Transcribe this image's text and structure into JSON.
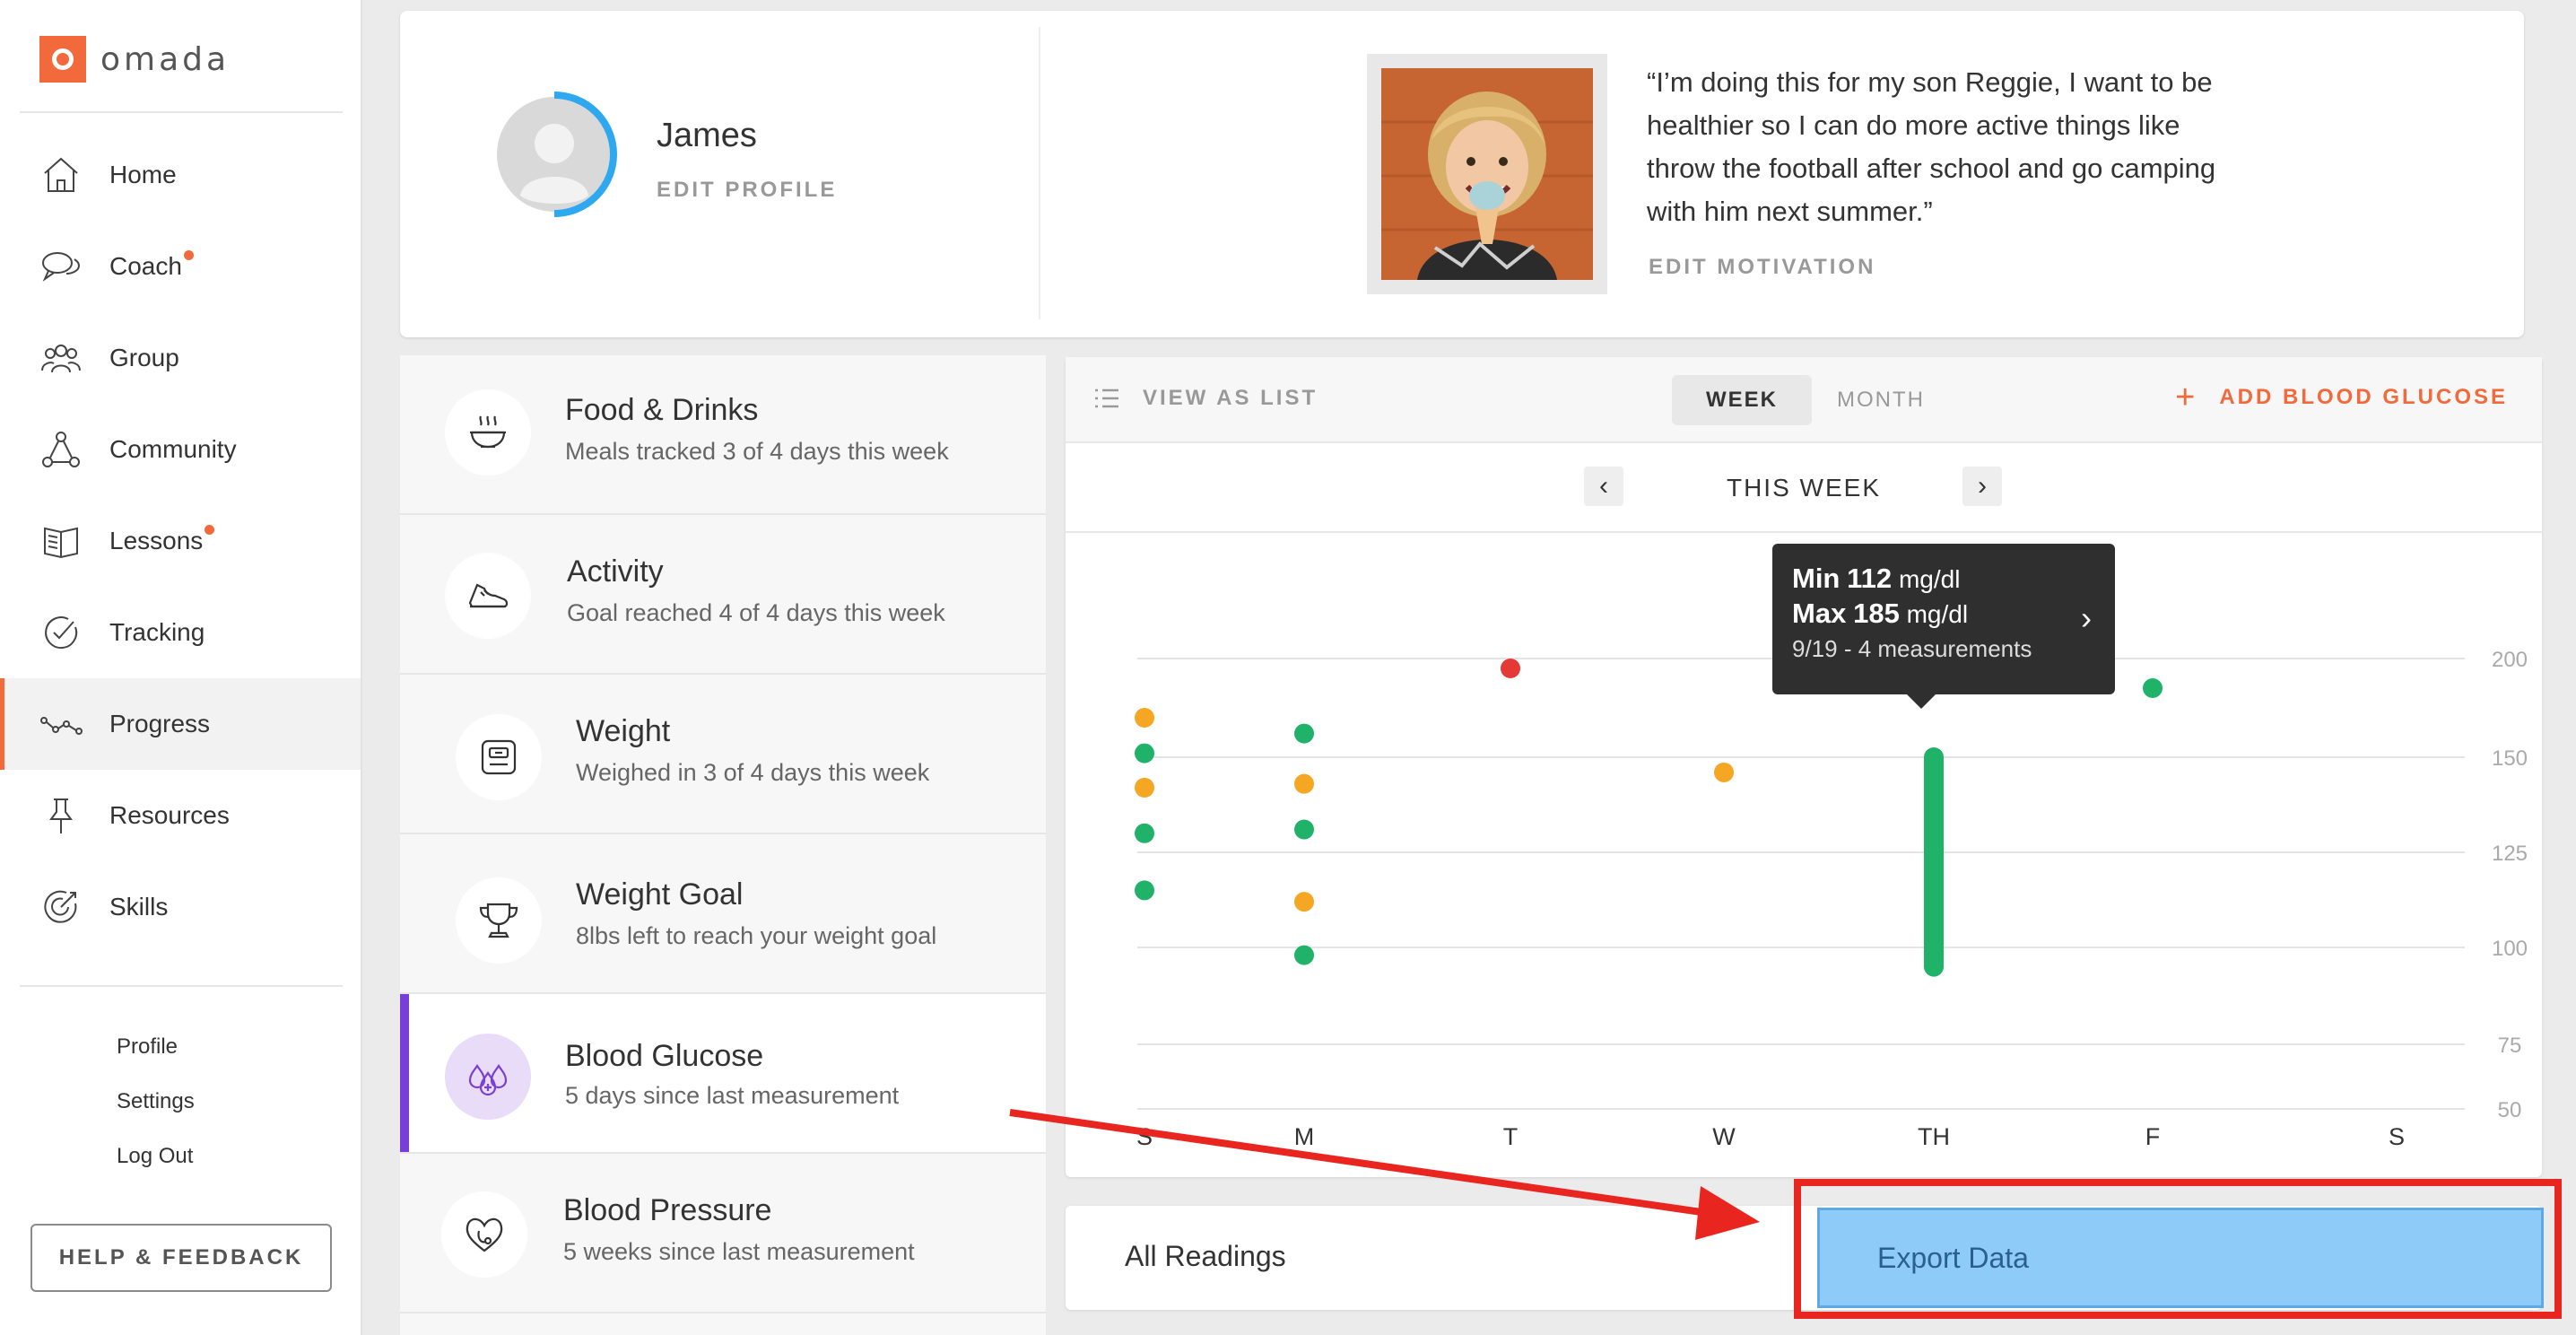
{
  "brand": {
    "name": "omada",
    "accent": "#f26a3b"
  },
  "nav": {
    "items": [
      {
        "label": "Home",
        "icon": "home-icon",
        "badge": false
      },
      {
        "label": "Coach",
        "icon": "chat-bubbles-icon",
        "badge": true
      },
      {
        "label": "Group",
        "icon": "group-icon",
        "badge": false
      },
      {
        "label": "Community",
        "icon": "community-icon",
        "badge": false
      },
      {
        "label": "Lessons",
        "icon": "book-icon",
        "badge": true
      },
      {
        "label": "Tracking",
        "icon": "checkmark-circle-icon",
        "badge": false
      },
      {
        "label": "Progress",
        "icon": "progress-line-icon",
        "badge": false,
        "active": true
      },
      {
        "label": "Resources",
        "icon": "pushpin-icon",
        "badge": false
      },
      {
        "label": "Skills",
        "icon": "target-icon",
        "badge": false
      }
    ],
    "secondary": [
      "Profile",
      "Settings",
      "Log Out"
    ],
    "help_label": "HELP & FEEDBACK"
  },
  "profile": {
    "name": "James",
    "edit_label": "EDIT PROFILE",
    "quote": "“I’m doing this for my son Reggie, I want to be healthier so I can do more active things like throw the football after school and go camping with him next summer.”",
    "edit_motivation_label": "EDIT MOTIVATION"
  },
  "metrics": [
    {
      "title": "Food & Drinks",
      "subtitle": "Meals tracked 3 of 4 days this week",
      "icon": "food-bowl-icon"
    },
    {
      "title": "Activity",
      "subtitle": "Goal reached 4 of 4 days this week",
      "icon": "sneaker-icon"
    },
    {
      "title": "Weight",
      "subtitle": "Weighed in 3 of 4 days this week",
      "icon": "scale-icon"
    },
    {
      "title": "Weight Goal",
      "subtitle": "8lbs left to reach your weight goal",
      "icon": "trophy-icon"
    },
    {
      "title": "Blood Glucose",
      "subtitle": "5 days since last measurement",
      "icon": "glucose-drops-icon",
      "active": true
    },
    {
      "title": "Blood Pressure",
      "subtitle": "5 weeks since last measurement",
      "icon": "heart-stethoscope-icon"
    }
  ],
  "chart_toolbar": {
    "view_list_label": "VIEW AS LIST",
    "tabs": [
      "WEEK",
      "MONTH"
    ],
    "active_tab": "WEEK",
    "add_label": "ADD BLOOD GLUCOSE",
    "week_label": "THIS WEEK",
    "prev_glyph": "‹",
    "next_glyph": "›"
  },
  "chart_data": {
    "type": "scatter",
    "categories": [
      "S",
      "M",
      "T",
      "W",
      "TH",
      "F",
      "S"
    ],
    "yticks": [
      50,
      75,
      100,
      125,
      150,
      200
    ],
    "points": [
      {
        "day": 0,
        "value": 170,
        "color": "#f5a623"
      },
      {
        "day": 0,
        "value": 152,
        "color": "#21b26a"
      },
      {
        "day": 0,
        "value": 142,
        "color": "#f5a623"
      },
      {
        "day": 0,
        "value": 130,
        "color": "#21b26a"
      },
      {
        "day": 0,
        "value": 115,
        "color": "#21b26a"
      },
      {
        "day": 1,
        "value": 162,
        "color": "#21b26a"
      },
      {
        "day": 1,
        "value": 143,
        "color": "#f5a623"
      },
      {
        "day": 1,
        "value": 131,
        "color": "#21b26a"
      },
      {
        "day": 1,
        "value": 112,
        "color": "#f5a623"
      },
      {
        "day": 1,
        "value": 98,
        "color": "#21b26a"
      },
      {
        "day": 2,
        "value": 195,
        "color": "#e53935"
      },
      {
        "day": 3,
        "value": 146,
        "color": "#f5a623"
      },
      {
        "day": 5,
        "value": 185,
        "color": "#21b26a"
      }
    ],
    "ranges": [
      {
        "day": 4,
        "min": 95,
        "max": 150,
        "color": "#21b26a"
      }
    ],
    "colors": {
      "normal": "#21b26a",
      "elevated": "#f5a623",
      "high": "#e53935"
    }
  },
  "tooltip": {
    "min_label": "Min",
    "min_value": "112",
    "max_label": "Max",
    "max_value": "185",
    "unit": "mg/dl",
    "detail": "9/19 - 4 measurements"
  },
  "bottom": {
    "all_readings_label": "All Readings",
    "export_label": "Export Data"
  }
}
